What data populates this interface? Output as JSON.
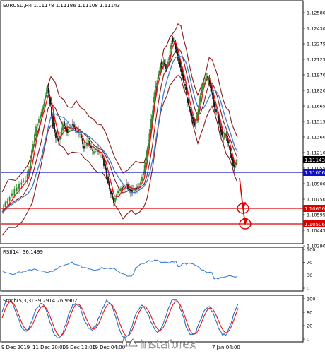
{
  "main": {
    "header": "EURUSD,H4  1.11178 1.11186 1.11108 1.11143",
    "price_ticks": [
      "1.12580",
      "1.12430",
      "1.12275",
      "1.12125",
      "1.11970",
      "1.11820",
      "1.11665",
      "1.11515",
      "1.11360",
      "1.11210",
      "1.11055",
      "1.10900",
      "1.10750",
      "1.10595",
      "1.10445",
      "1.10290"
    ],
    "current_price": "1.11143",
    "support_labels": {
      "blue": "1.11006",
      "red1": "1.10656",
      "red2": "1.10506"
    }
  },
  "rsi": {
    "label": "RSI(14) 36.1499",
    "ticks": [
      "100",
      "70",
      "30",
      "0"
    ]
  },
  "stoch": {
    "label": "Stoch(5,3,3) 39.2914 26.9902",
    "ticks": [
      "100",
      "80",
      "20",
      "0"
    ]
  },
  "x_ticks": [
    "9 Dec 2019",
    "11 Dec 20:00",
    "16 Dec 12:00",
    "19 Dec 04:00",
    "7 Jan 04:00"
  ],
  "watermark": "instaforex",
  "colors": {
    "background": "#ffffff",
    "bull_candle": "#2e8b2e",
    "bear_candle": "#111111",
    "bollinger": "#8b1a1a",
    "ma_fast": "#ee1111",
    "ma_slow": "#3a7fd5",
    "support_blue": "#1010c8",
    "support_red": "#dd0000",
    "rsi_line": "#3a7fd5",
    "stoch_main": "#1f6fd0",
    "stoch_signal": "#ee1111"
  },
  "icons": [
    "logo-icon"
  ]
}
